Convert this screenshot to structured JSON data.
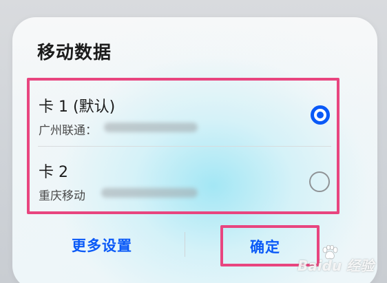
{
  "dialog": {
    "title": "移动数据",
    "sims": [
      {
        "name": "卡 1 (默认)",
        "carrier": "广州联通：",
        "selected": true
      },
      {
        "name": "卡 2",
        "carrier": "重庆移动",
        "selected": false
      }
    ],
    "buttons": {
      "more_settings": "更多设置",
      "confirm": "确定"
    }
  },
  "colors": {
    "accent": "#0a59f7",
    "highlight_frame": "#e8457f"
  },
  "watermark": {
    "text": "Baidu 经验"
  }
}
